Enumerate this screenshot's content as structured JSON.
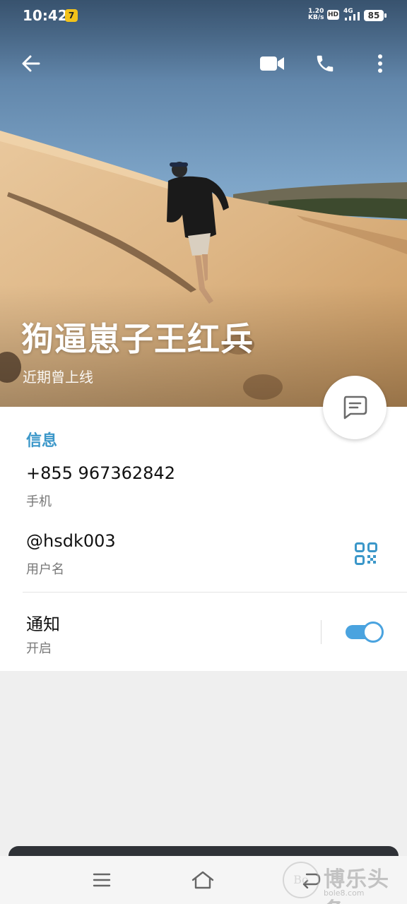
{
  "status_bar": {
    "time": "10:42",
    "app_badge": "7",
    "net_speed_value": "1.20",
    "net_speed_unit": "KB/s",
    "hd": "HD",
    "network": "4G",
    "battery": "85"
  },
  "header": {
    "back_icon": "arrow-left-icon",
    "video_icon": "video-camera-icon",
    "call_icon": "phone-icon",
    "more_icon": "more-vertical-icon"
  },
  "profile": {
    "name": "狗逼崽子王红兵",
    "status": "近期曾上线"
  },
  "fab": {
    "icon": "message-icon"
  },
  "info": {
    "section_title": "信息",
    "phone": {
      "value": "+855 967362842",
      "label": "手机"
    },
    "username": {
      "value": "@hsdk003",
      "label": "用户名",
      "icon": "qr-code-icon"
    },
    "notifications": {
      "title": "通知",
      "state": "开启",
      "enabled": true
    }
  },
  "navbar": {
    "menu_icon": "menu-icon",
    "home_icon": "home-icon",
    "back_icon": "back-icon"
  },
  "watermark": {
    "logo_text": "Bo",
    "text": "博乐头条",
    "url": "bole8.com"
  },
  "colors": {
    "accent": "#3b97c9",
    "toggle_on": "#4aa3df"
  }
}
